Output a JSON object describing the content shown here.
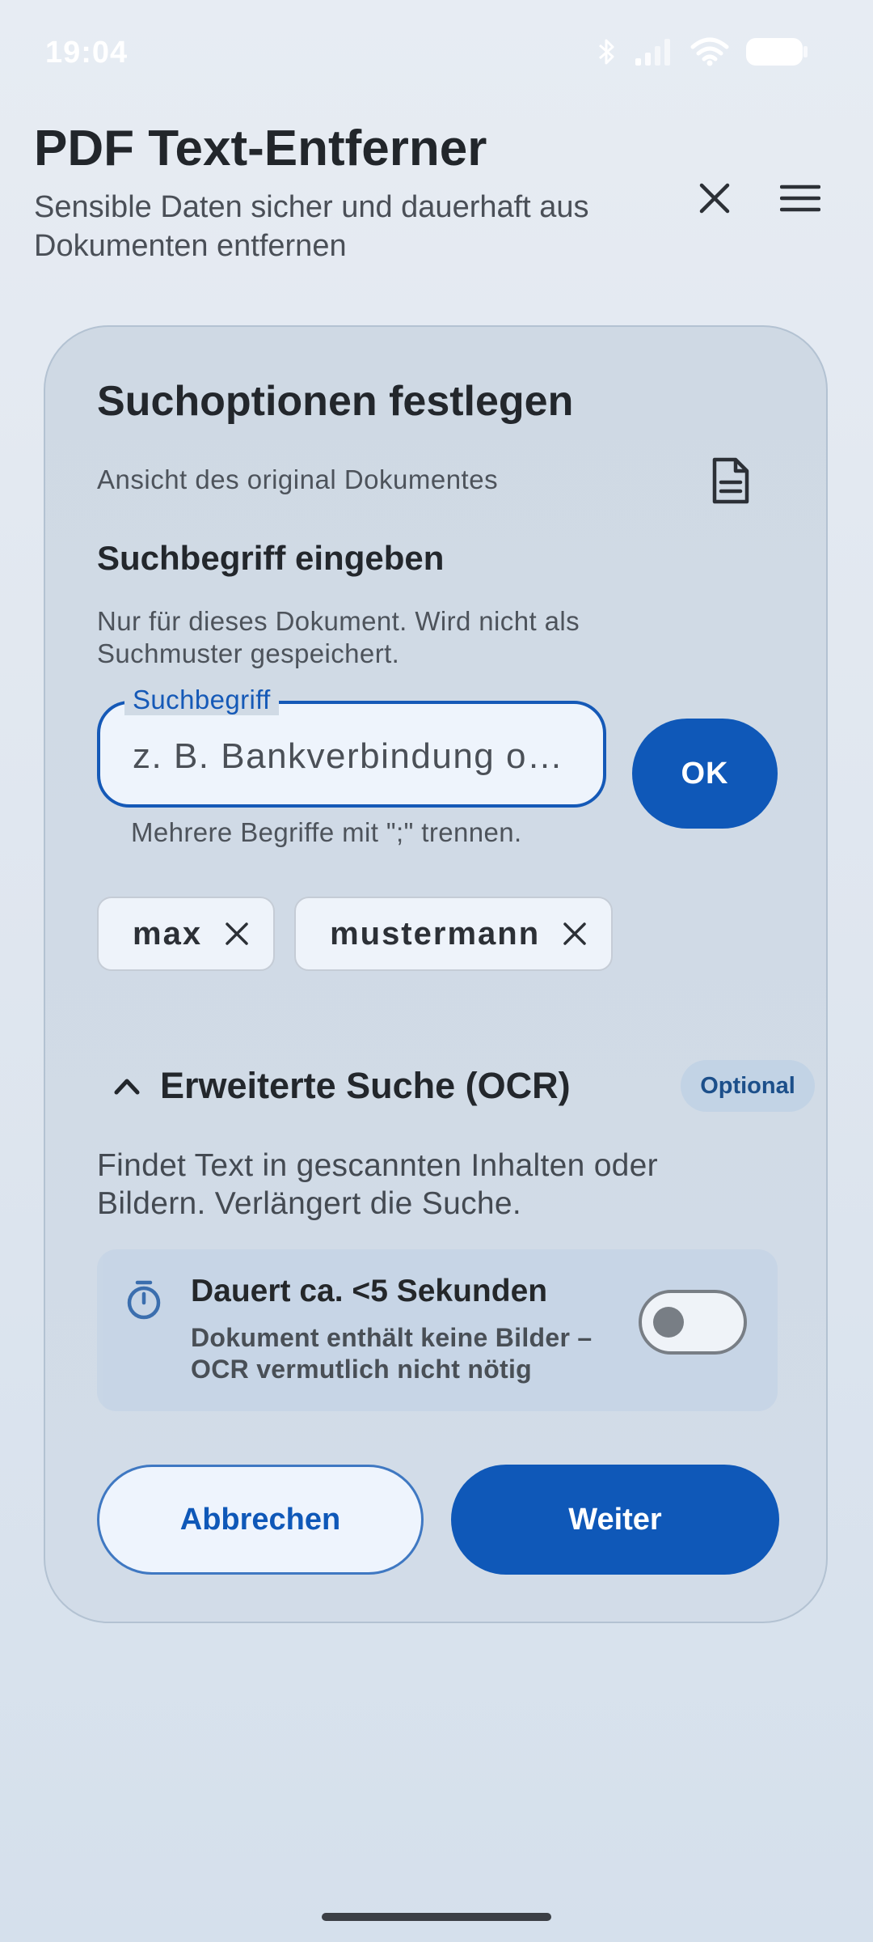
{
  "status_bar": {
    "time": "19:04"
  },
  "header": {
    "title": "PDF Text-Entferner",
    "subtitle": "Sensible Daten sicher und dauerhaft aus Dokumenten entfernen"
  },
  "card": {
    "title": "Suchoptionen festlegen",
    "doc_label": "Ansicht des original Dokumentes",
    "search_heading": "Suchbegriff eingeben",
    "search_hint": "Nur für dieses Dokument. Wird nicht als Suchmuster gespeichert.",
    "search_field": {
      "label": "Suchbegriff",
      "placeholder": "z. B. Bankverbindung o…",
      "value": ""
    },
    "ok_label": "OK",
    "helper_text": "Mehrere Begriffe mit \";\" trennen.",
    "chips": [
      {
        "label": "max"
      },
      {
        "label": "mustermann"
      }
    ],
    "ocr": {
      "title": "Erweiterte Suche (OCR)",
      "badge": "Optional",
      "description": "Findet Text in gescannten Inhalten oder Bildern. Verlängert die Suche.",
      "duration_title": "Dauert ca. <5 Sekunden",
      "duration_note": "Dokument enthält keine Bilder – OCR vermutlich nicht nötig",
      "enabled": false
    },
    "cancel_label": "Abbrechen",
    "continue_label": "Weiter"
  },
  "colors": {
    "primary": "#0f58b8",
    "background": "#e3e9f1",
    "card": "#cfd9e4"
  }
}
